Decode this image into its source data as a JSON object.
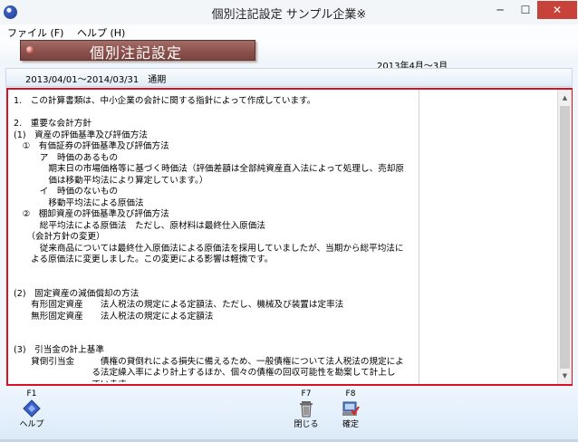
{
  "window": {
    "title": "個別注記設定 サンプル企業※",
    "min_glyph": "─",
    "max_glyph": "☐",
    "close_glyph": "✕"
  },
  "menu": {
    "file": "ファイル (F)",
    "help": "ヘルプ (H)"
  },
  "header": {
    "banner_title": "個別注記設定",
    "period_months": "2013年4月～3月"
  },
  "subbar": {
    "fiscal_period": "2013/04/01～2014/03/31　通期"
  },
  "note_lines": [
    "1.　この計算書類は、中小企業の会計に関する指針によって作成しています。",
    "",
    "2.　重要な会計方針",
    "(1)　資産の評価基準及び評価方法",
    "　①　有価証券の評価基準及び評価方法",
    "　　　ア　時価のあるもの",
    "　　　　期末日の市場価格等に基づく時価法（評価差額は全部純資産直入法によって処理し、売却原",
    "　　　　価は移動平均法により算定しています。）",
    "　　　イ　時価のないもの",
    "　　　　移動平均法による原価法",
    "　②　棚卸資産の評価基準及び評価方法",
    "　　　総平均法による原価法　ただし、原材料は最終仕入原価法",
    "　　（会計方針の変更）",
    "　　　従来商品については最終仕入原価法による原価法を採用していましたが、当期から総平均法に",
    "　　よる原価法に変更しました。この変更による影響は軽微です。",
    "",
    "",
    "(2)　固定資産の減価償却の方法",
    "　　有形固定資産　　法人税法の規定による定額法、ただし、機械及び装置は定率法",
    "　　無形固定資産　　法人税法の規定による定額法",
    "",
    "",
    "(3)　引当金の計上基準",
    "　　貸倒引当金　　　債権の貸倒れによる損失に備えるため、一般債権について法人税法の規定によ",
    "　　　　　　　　　る法定繰入率により計上するほか、個々の債権の回収可能性を勘案して計上し",
    "　　　　　　　　　ています。"
  ],
  "footer": {
    "f1": {
      "code": "F1",
      "label": "ヘルプ"
    },
    "f7": {
      "code": "F7",
      "label": "閉じる"
    },
    "f8": {
      "code": "F8",
      "label": "確定"
    }
  },
  "colors": {
    "accent_border": "#d8101f",
    "banner": "#8a4f4a",
    "close_button": "#c7433a"
  },
  "icons": [
    "app-icon",
    "help-icon",
    "trash-icon",
    "confirm-icon",
    "scroll-up-icon",
    "scroll-down-icon"
  ]
}
